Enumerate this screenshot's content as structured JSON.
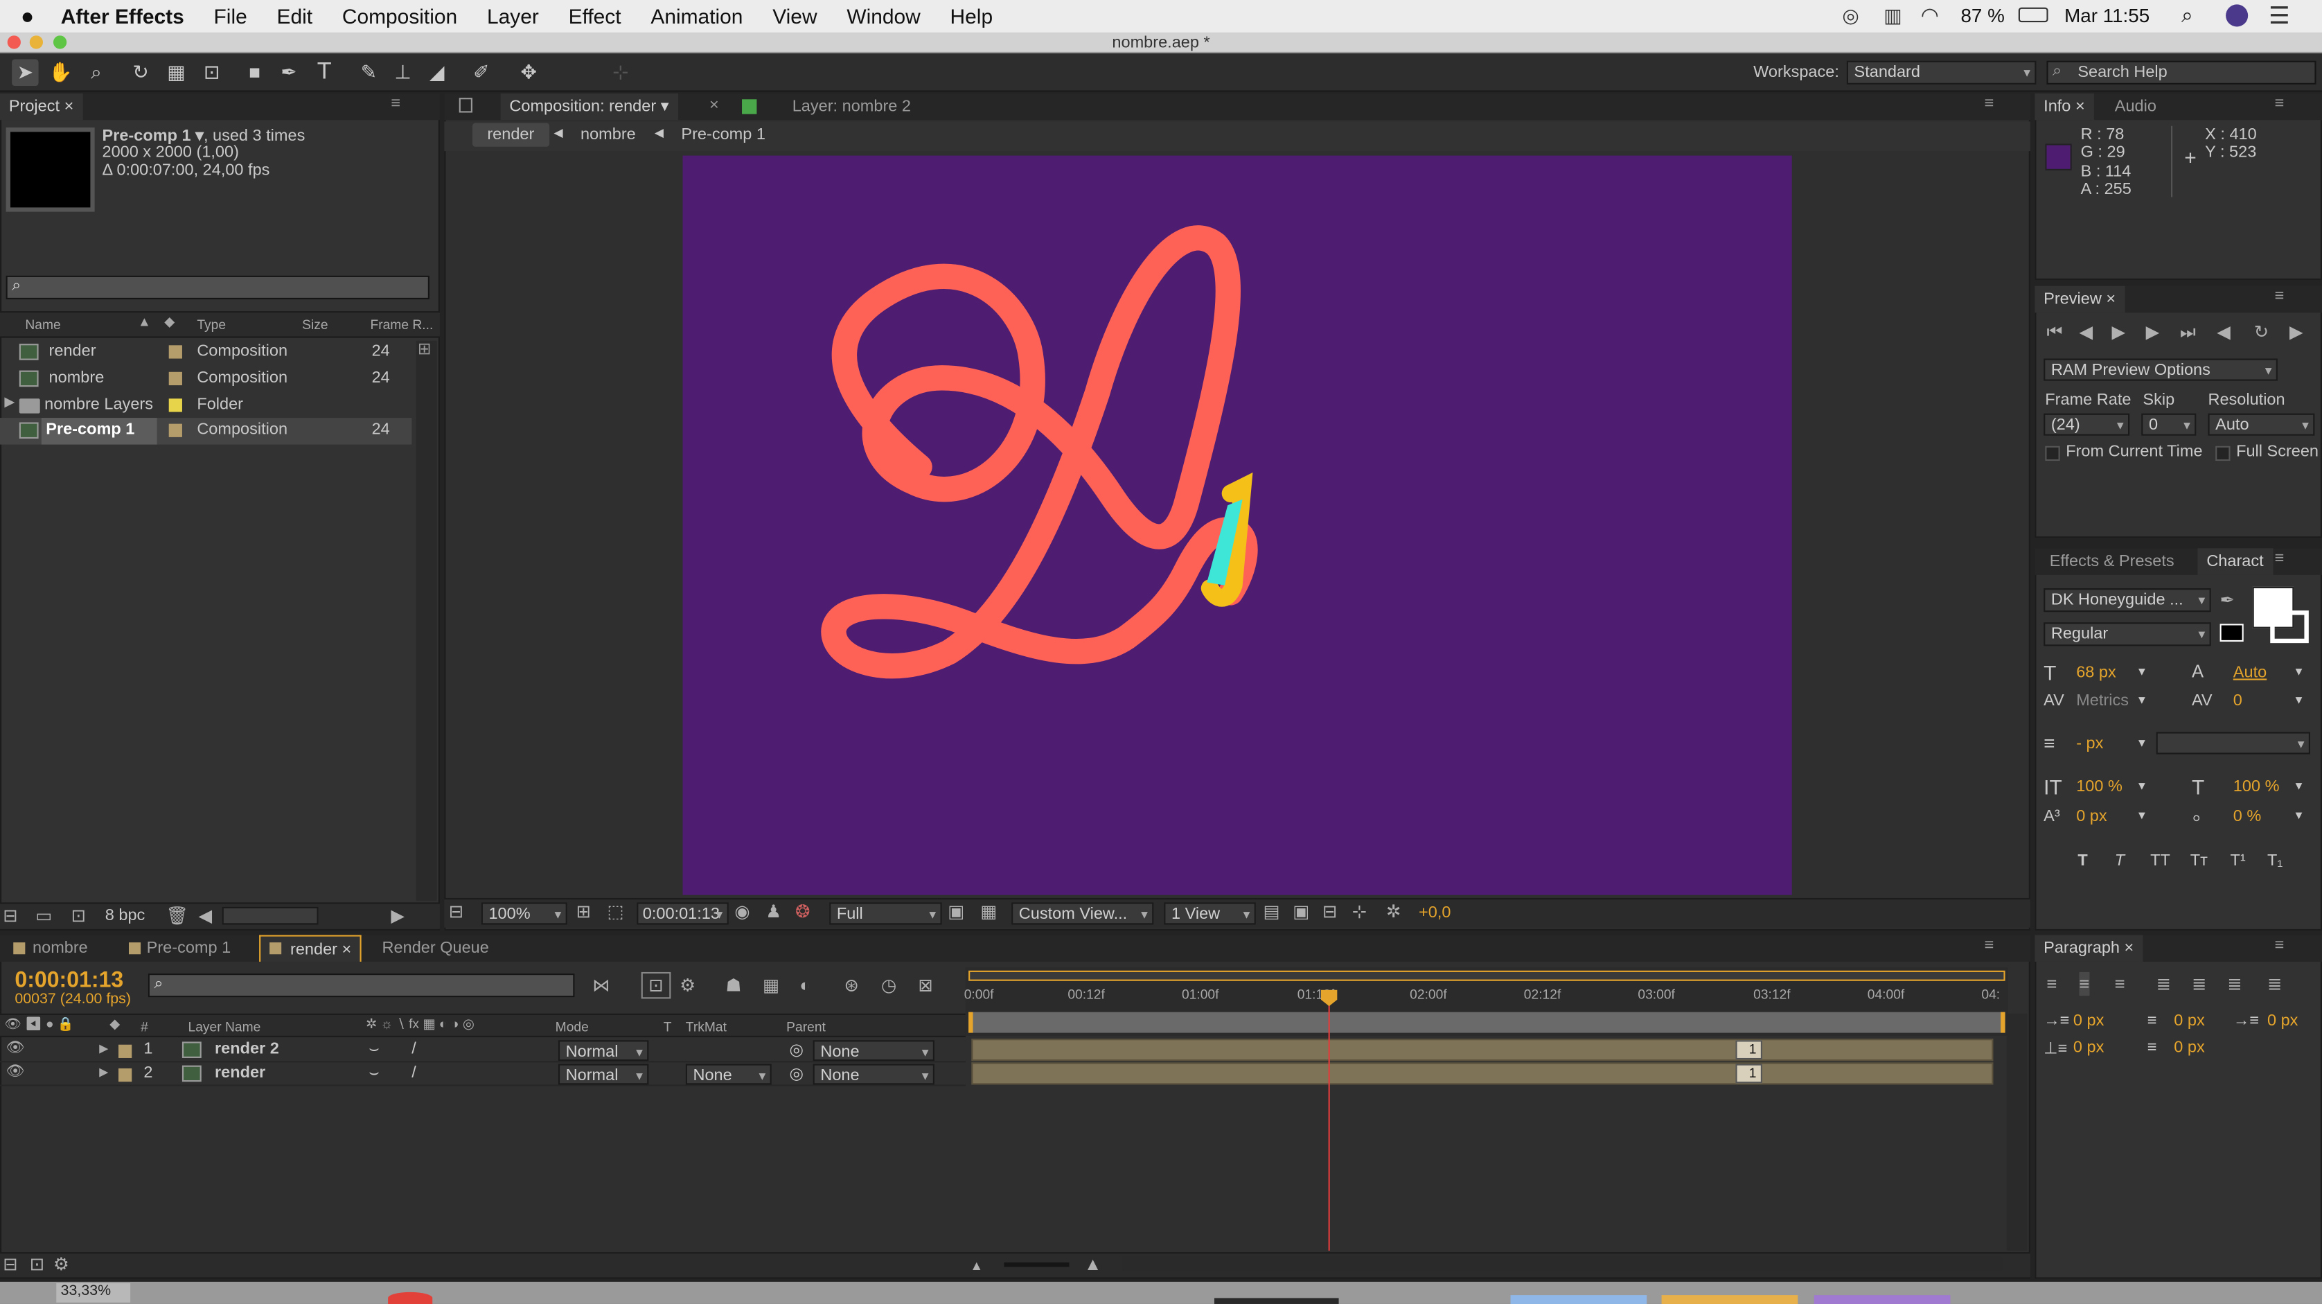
{
  "menubar": {
    "apple": "",
    "app_name": "After Effects",
    "items": [
      "File",
      "Edit",
      "Composition",
      "Layer",
      "Effect",
      "Animation",
      "View",
      "Window",
      "Help"
    ],
    "battery": "87 %",
    "clock": "Mar 11:55"
  },
  "window": {
    "title": "nombre.aep *"
  },
  "toolbar": {
    "workspace_label": "Workspace:",
    "workspace_value": "Standard",
    "search_placeholder": "Search Help"
  },
  "project": {
    "tab": "Project",
    "item_name": "Pre-comp 1 ▾",
    "item_used": ", used 3 times",
    "item_size": "2000 x 2000 (1,00)",
    "item_duration": "Δ 0:00:07:00, 24,00 fps",
    "columns": {
      "name": "Name",
      "type": "Type",
      "size": "Size",
      "frame_rate": "Frame R..."
    },
    "items": [
      {
        "name": "render",
        "type": "Composition",
        "rate": "24",
        "color": "#b59c6b"
      },
      {
        "name": "nombre",
        "type": "Composition",
        "rate": "24",
        "color": "#b59c6b"
      },
      {
        "name": "nombre Layers",
        "type": "Folder",
        "rate": "",
        "color": "#e8d44a"
      },
      {
        "name": "Pre-comp 1",
        "type": "Composition",
        "rate": "24",
        "color": "#b59c6b"
      }
    ],
    "bpc": "8 bpc"
  },
  "composition": {
    "tab": "Composition: render",
    "layer_tab": "Layer: nombre 2",
    "breadcrumbs": [
      "render",
      "nombre",
      "Pre-comp 1"
    ],
    "bg_color": "#4e1d72",
    "logo_color": "#fe6257",
    "accent_cyan": "#3ee6d8",
    "accent_yellow": "#f5c118",
    "footer": {
      "zoom": "100%",
      "timecode": "0:00:01:13",
      "resolution": "Full",
      "view": "Custom View...",
      "views": "1 View",
      "exposure": "+0,0"
    }
  },
  "info": {
    "tab": "Info",
    "tab2": "Audio",
    "r": "R : 78",
    "g": "G : 29",
    "b": "B : 114",
    "a": "A : 255",
    "x": "X : 410",
    "y": "Y : 523",
    "swatch": "#4e1d72"
  },
  "preview": {
    "tab": "Preview",
    "ram_options": "RAM Preview Options",
    "frame_rate_label": "Frame Rate",
    "skip_label": "Skip",
    "resolution_label": "Resolution",
    "frame_rate_value": "(24)",
    "skip_value": "0",
    "resolution_value": "Auto",
    "from_current": "From Current Time",
    "full_screen": "Full Screen"
  },
  "character": {
    "tab1": "Effects & Presets",
    "tab2": "Charact",
    "font": "DK Honeyguide ...",
    "style": "Regular",
    "size": "68 px",
    "leading": "Auto",
    "kerning": "Metrics",
    "tracking": "0",
    "stroke": "- px",
    "vscale": "100 %",
    "hscale": "100 %",
    "baseline": "0 px",
    "tsume": "0 %",
    "type_buttons": [
      "T",
      "T",
      "TT",
      "Tт",
      "T¹",
      "T₁"
    ]
  },
  "paragraph": {
    "tab": "Paragraph",
    "values": [
      "0 px",
      "0 px",
      "0 px",
      "0 px",
      "0 px"
    ]
  },
  "timeline": {
    "tabs": [
      "nombre",
      "Pre-comp 1",
      "render",
      "Render Queue"
    ],
    "timecode": "0:00:01:13",
    "frame_info": "00037 (24.00 fps)",
    "columns": {
      "layer_name": "Layer Name",
      "mode": "Mode",
      "t": "T",
      "trkmat": "TrkMat",
      "parent": "Parent",
      "hash": "#"
    },
    "ruler": [
      "0:00f",
      "00:12f",
      "01:00f",
      "01:12f",
      "02:00f",
      "02:12f",
      "03:00f",
      "03:12f",
      "04:00f",
      "04:"
    ],
    "layers": [
      {
        "num": "1",
        "name": "render 2",
        "mode": "Normal",
        "trkmat": "",
        "parent": "None"
      },
      {
        "num": "2",
        "name": "render",
        "mode": "Normal",
        "trkmat": "None",
        "parent": "None"
      }
    ],
    "marker": "1"
  },
  "dock": {
    "zoom": "33,33%"
  }
}
